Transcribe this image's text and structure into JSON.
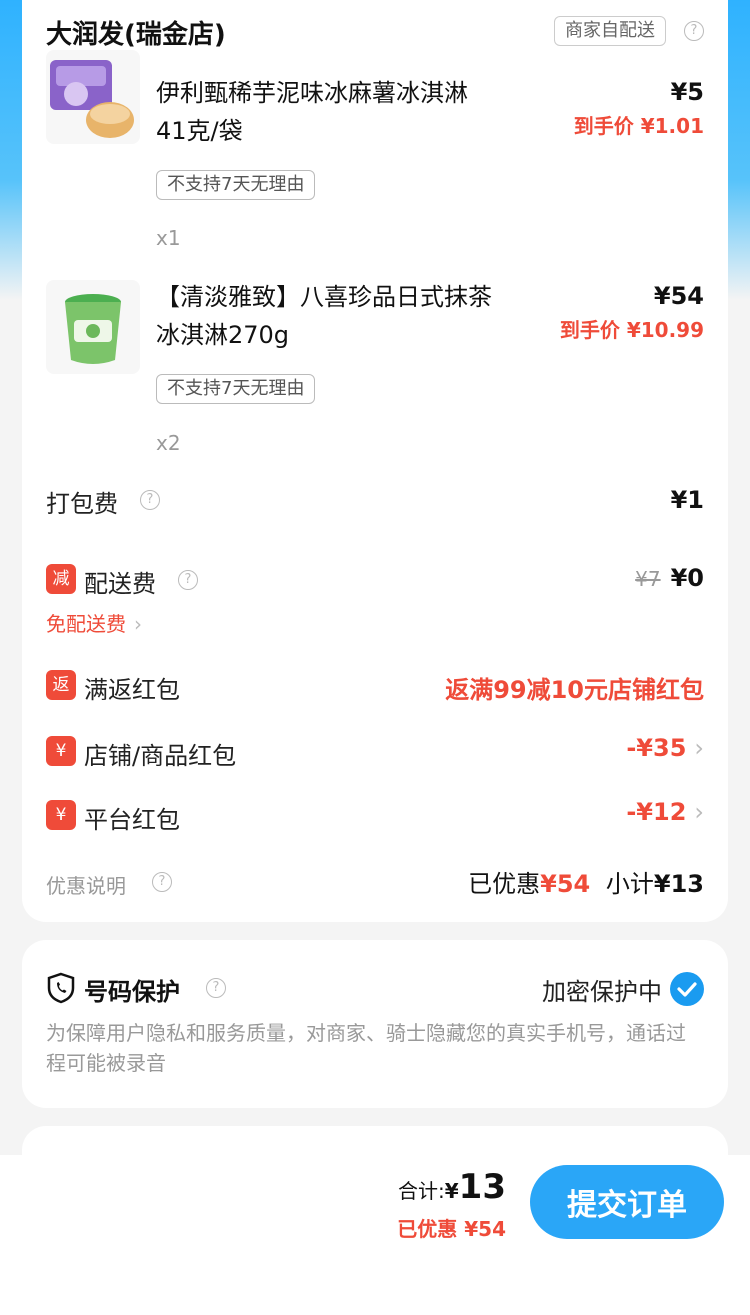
{
  "store": {
    "name": "大润发(瑞金店)",
    "delivery_badge": "商家自配送"
  },
  "products": [
    {
      "name": "伊利甄稀芋泥味冰麻薯冰淇淋41克/袋",
      "price": "¥5",
      "final_price": "到手价 ¥1.01",
      "return_policy": "不支持7天无理由",
      "quantity": "x1"
    },
    {
      "name": "【清淡雅致】八喜珍品日式抹茶冰淇淋270g",
      "price": "¥54",
      "final_price": "到手价 ¥10.99",
      "return_policy": "不支持7天无理由",
      "quantity": "x2"
    }
  ],
  "fees": {
    "packing_label": "打包费",
    "packing_value": "¥1",
    "delivery_badge": "减",
    "delivery_label": "配送费",
    "delivery_original": "¥7",
    "delivery_value": "¥0",
    "free_delivery_link": "免配送费"
  },
  "promotions": {
    "cashback_badge": "返",
    "cashback_label": "满返红包",
    "cashback_value": "返满99减10元店铺红包",
    "shop_badge": "¥",
    "shop_label": "店铺/商品红包",
    "shop_value": "-¥35",
    "platform_badge": "¥",
    "platform_label": "平台红包",
    "platform_value": "-¥12"
  },
  "summary": {
    "discount_note_label": "优惠说明",
    "saved_label": "已优惠",
    "saved_value": "¥54",
    "subtotal_label": "小计",
    "subtotal_value": "¥13"
  },
  "privacy": {
    "title": "号码保护",
    "status": "加密保护中",
    "description": "为保障用户隐私和服务质量，对商家、骑士隐藏您的真实手机号，通话过程可能被录音"
  },
  "bottom": {
    "total_label": "合计:",
    "total_currency": "¥",
    "total_amount": "13",
    "saved_text": "已优惠 ¥54",
    "submit_label": "提交订单"
  },
  "colors": {
    "accent_blue": "#2aa6f7",
    "discount_red": "#ef4b39"
  }
}
